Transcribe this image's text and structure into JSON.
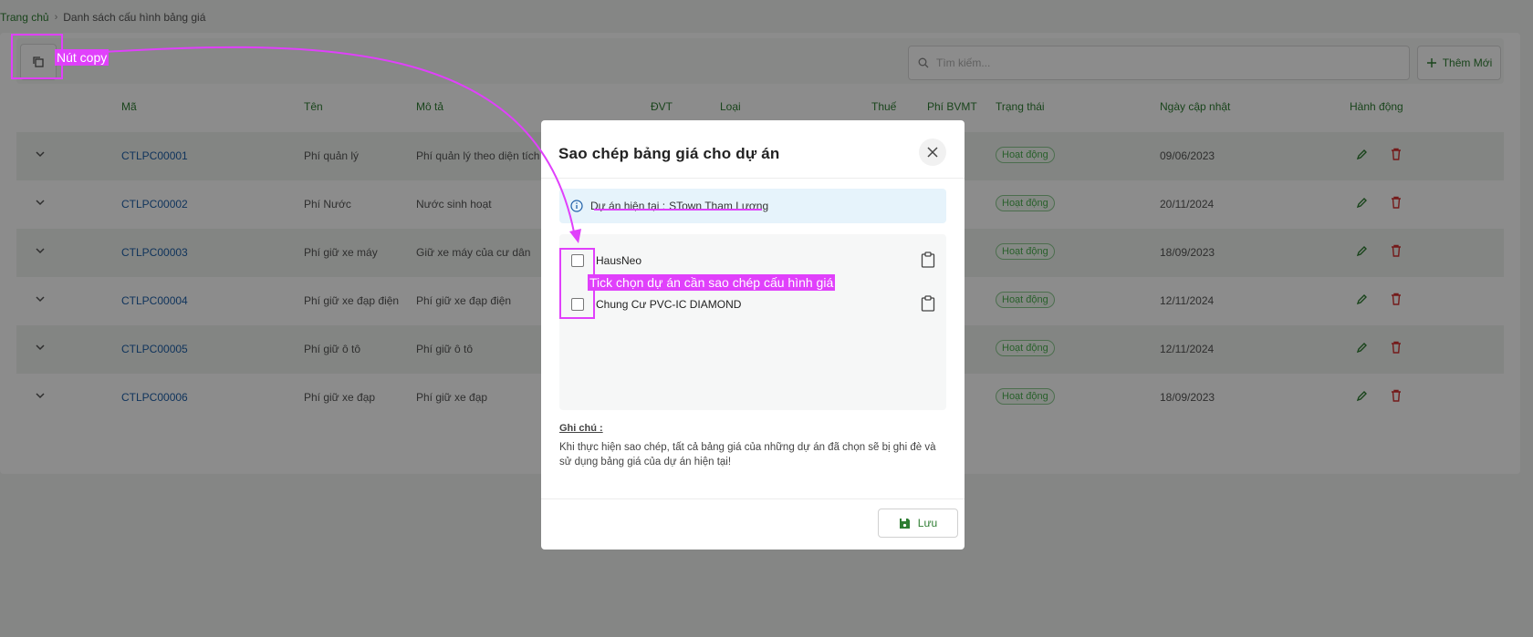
{
  "breadcrumb": {
    "home": "Trang chủ",
    "current": "Danh sách cấu hình bảng giá"
  },
  "toolbar": {
    "search_placeholder": "Tìm kiếm...",
    "add_label": "Thêm Mới"
  },
  "table": {
    "headers": [
      "Mã",
      "Tên",
      "Mô tả",
      "ĐVT",
      "Loại",
      "Thuế",
      "Phí BVMT",
      "Trạng thái",
      "Ngày cập nhật",
      "Hành động"
    ],
    "rows": [
      {
        "code": "CTLPC00001",
        "name": "Phí quản lý",
        "desc": "Phí quản lý theo diện tích c",
        "status": "Hoạt động",
        "date": "09/06/2023"
      },
      {
        "code": "CTLPC00002",
        "name": "Phí Nước",
        "desc": "Nước sinh hoạt",
        "status": "Hoạt động",
        "date": "20/11/2024"
      },
      {
        "code": "CTLPC00003",
        "name": "Phí giữ xe máy",
        "desc": "Giữ xe máy của cư dân",
        "status": "Hoạt động",
        "date": "18/09/2023"
      },
      {
        "code": "CTLPC00004",
        "name": "Phí giữ xe đạp điện",
        "desc": "Phí giữ xe đạp điện",
        "status": "Hoạt động",
        "date": "12/11/2024"
      },
      {
        "code": "CTLPC00005",
        "name": "Phí giữ ô tô",
        "desc": "Phí giữ ô tô",
        "status": "Hoạt động",
        "date": "12/11/2024"
      },
      {
        "code": "CTLPC00006",
        "name": "Phí giữ xe đạp",
        "desc": "Phí giữ xe đạp",
        "status": "Hoạt động",
        "date": "18/09/2023"
      }
    ]
  },
  "modal": {
    "title": "Sao chép bảng giá cho dự án",
    "info_label": "Dự án hiện tại :",
    "info_value": "STown Tham Lương",
    "projects": [
      {
        "name": "HausNeo"
      },
      {
        "name": "Chung Cư PVC-IC DIAMOND"
      }
    ],
    "note_label": "Ghi chú :",
    "note_text": "Khi thực hiện sao chép, tất cả bảng giá của những dự án đã chọn sẽ bị ghi đè và sử dụng bảng giá của dự án hiện tại!",
    "save_label": "Lưu"
  },
  "annotations": {
    "copy_label": "Nút copy",
    "checkbox_label": "Tick chọn dự án cần sao chép cấu hình giá"
  },
  "colors": {
    "accent": "#2e7d32",
    "link": "#1e5fa8",
    "annotation": "#e040fb",
    "delete": "#d32f2f"
  }
}
